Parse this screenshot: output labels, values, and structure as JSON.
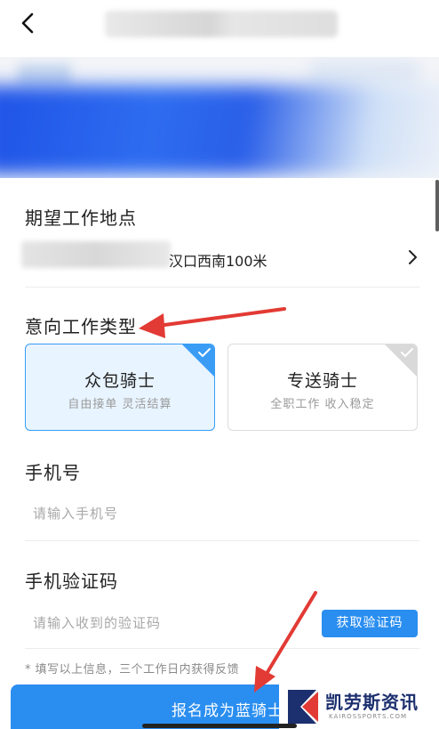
{
  "nav": {
    "back_icon": "chevron-left-icon"
  },
  "location": {
    "label": "期望工作地点",
    "value": "汉口西南100米",
    "chevron_icon": "chevron-right-icon"
  },
  "work_type": {
    "label": "意向工作类型",
    "options": [
      {
        "name": "众包骑士",
        "desc": "自由接单 灵活结算",
        "selected": true
      },
      {
        "name": "专送骑士",
        "desc": "全职工作 收入稳定",
        "selected": false
      }
    ]
  },
  "phone": {
    "label": "手机号",
    "placeholder": "请输入手机号"
  },
  "verify": {
    "label": "手机验证码",
    "placeholder": "请输入收到的验证码",
    "button": "获取验证码"
  },
  "note": "* 填写以上信息，三个工作日内获得反馈",
  "submit": {
    "label": "报名成为蓝骑士"
  },
  "watermark": {
    "title": "凯劳斯资讯",
    "subtitle": "KAIROSSPORTS.COM"
  },
  "colors": {
    "accent": "#2a8ef0",
    "selected_bg": "#e8f4ff",
    "annotation_arrow": "#e23a34"
  }
}
